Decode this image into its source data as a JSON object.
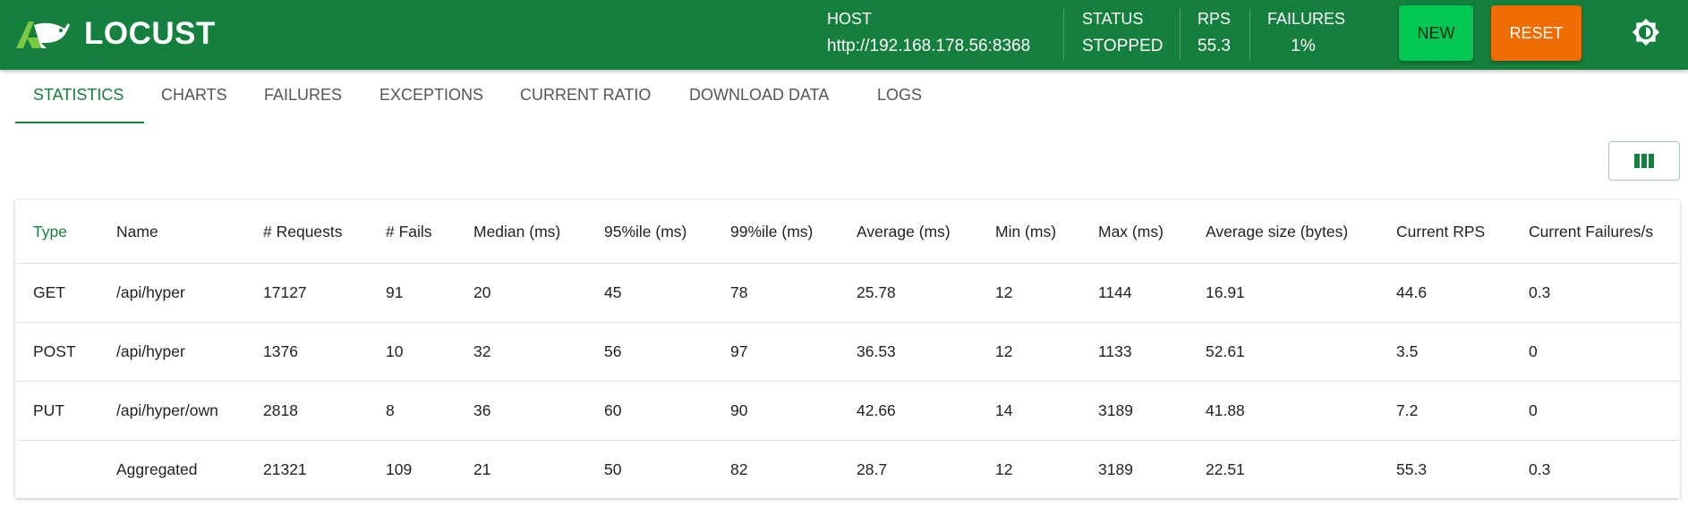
{
  "app": {
    "logo_text": "LOCUST",
    "brand_color": "#15803d"
  },
  "header": {
    "host_label": "HOST",
    "host_value": "http://192.168.178.56:8368",
    "status_label": "STATUS",
    "status_value": "STOPPED",
    "rps_label": "RPS",
    "rps_value": "55.3",
    "failures_label": "FAILURES",
    "failures_value": "1%",
    "new_button": "NEW",
    "reset_button": "RESET",
    "theme_icon": "brightness-icon"
  },
  "tabs": [
    {
      "label": "STATISTICS",
      "active": true
    },
    {
      "label": "CHARTS"
    },
    {
      "label": "FAILURES"
    },
    {
      "label": "EXCEPTIONS"
    },
    {
      "label": "CURRENT RATIO"
    },
    {
      "label": "DOWNLOAD DATA"
    },
    {
      "label": "LOGS"
    }
  ],
  "toolbar": {
    "columns_icon": "view-column-icon"
  },
  "table": {
    "headers": [
      "Type",
      "Name",
      "# Requests",
      "# Fails",
      "Median (ms)",
      "95%ile (ms)",
      "99%ile (ms)",
      "Average (ms)",
      "Min (ms)",
      "Max (ms)",
      "Average size (bytes)",
      "Current RPS",
      "Current Failures/s"
    ],
    "rows": [
      [
        "GET",
        "/api/hyper",
        "17127",
        "91",
        "20",
        "45",
        "78",
        "25.78",
        "12",
        "1144",
        "16.91",
        "44.6",
        "0.3"
      ],
      [
        "POST",
        "/api/hyper",
        "1376",
        "10",
        "32",
        "56",
        "97",
        "36.53",
        "12",
        "1133",
        "52.61",
        "3.5",
        "0"
      ],
      [
        "PUT",
        "/api/hyper/own",
        "2818",
        "8",
        "36",
        "60",
        "90",
        "42.66",
        "14",
        "3189",
        "41.88",
        "7.2",
        "0"
      ],
      [
        "",
        "Aggregated",
        "21321",
        "109",
        "21",
        "50",
        "82",
        "28.7",
        "12",
        "3189",
        "22.51",
        "55.3",
        "0.3"
      ]
    ]
  }
}
